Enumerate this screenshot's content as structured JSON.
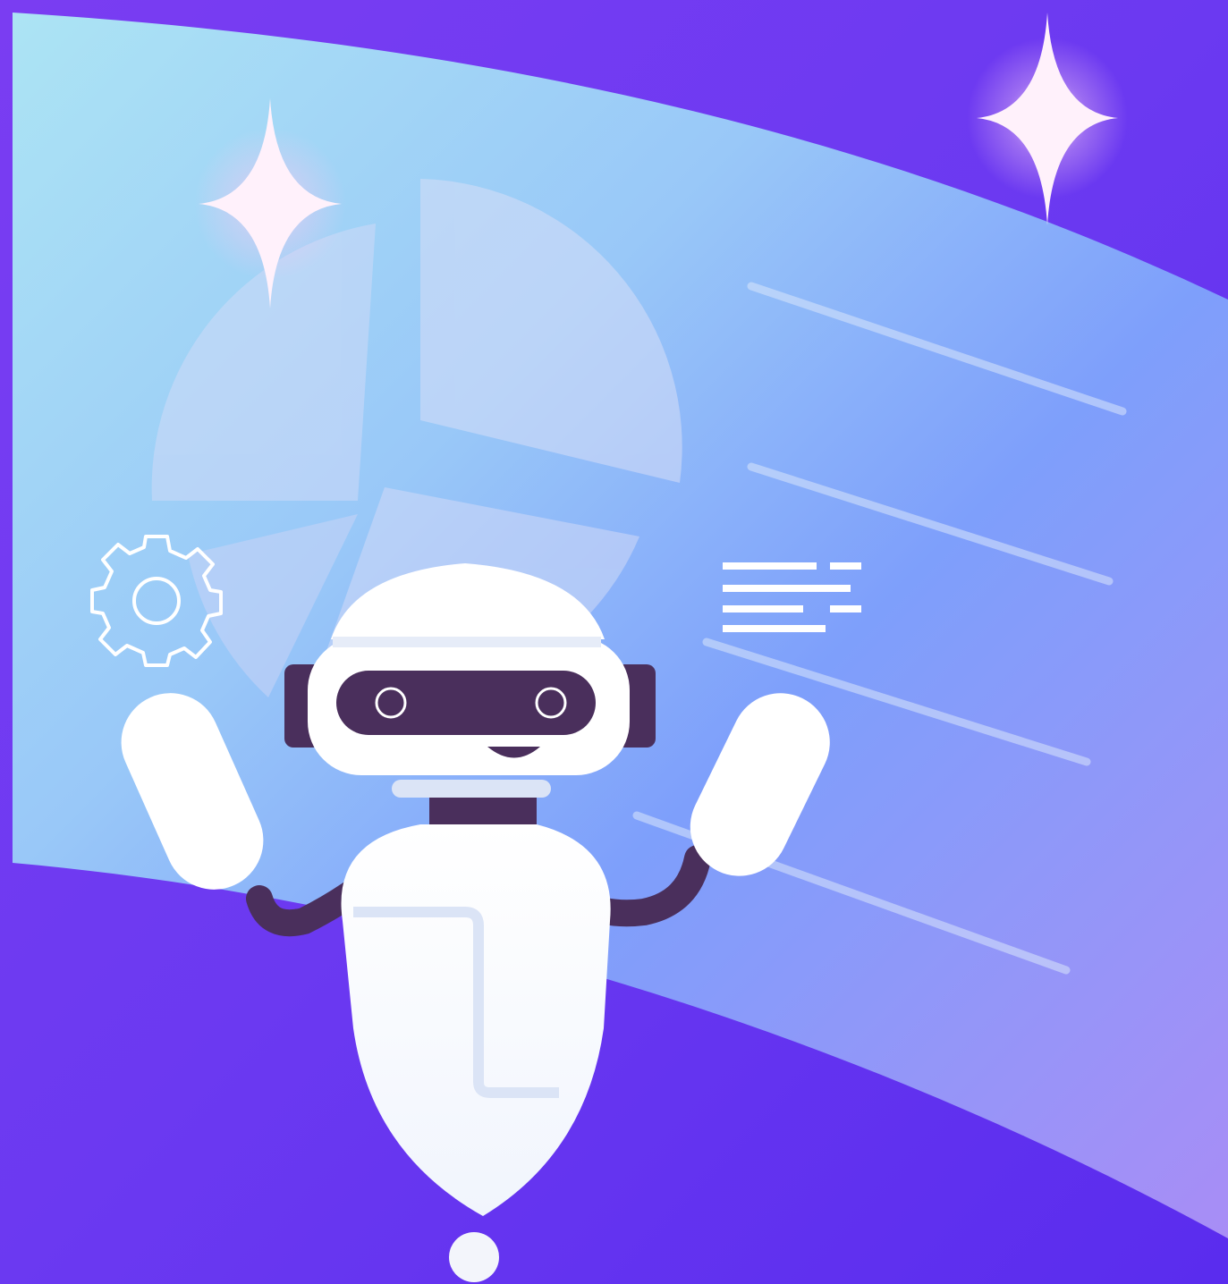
{
  "scene": {
    "description_name": "robot-illustration",
    "colors": {
      "bg_top": "#7a3df2",
      "bg_bottom": "#5b2ef0",
      "banner_top": "#a9e0f5",
      "banner_mid": "#7fa2fb",
      "banner_bottom": "#a58bf6",
      "robot_white": "#ffffff",
      "robot_shade": "#dbe4f6",
      "robot_dark": "#4a2f5c",
      "sparkle": "#fff1fb"
    },
    "icons": [
      "sparkle-icon",
      "gear-icon",
      "text-lines-icon",
      "pie-chart-graphic"
    ]
  }
}
